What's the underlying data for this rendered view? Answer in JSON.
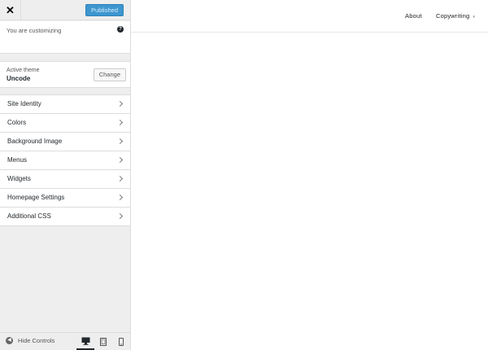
{
  "sidebar": {
    "close_icon": "✕",
    "published_label": "Published",
    "customizing_text": "You are customizing",
    "help_icon": "?",
    "theme": {
      "label": "Active theme",
      "name": "Uncode",
      "change_label": "Change"
    },
    "menu": [
      {
        "label": "Site Identity"
      },
      {
        "label": "Colors"
      },
      {
        "label": "Background Image"
      },
      {
        "label": "Menus"
      },
      {
        "label": "Widgets"
      },
      {
        "label": "Homepage Settings"
      },
      {
        "label": "Additional CSS"
      }
    ],
    "footer": {
      "hide_label": "Hide Controls",
      "devices": [
        "desktop-icon",
        "tablet-icon",
        "mobile-icon"
      ],
      "active_device": "desktop"
    }
  },
  "preview": {
    "nav": [
      {
        "label": "About"
      },
      {
        "label": "Copywriting",
        "has_dropdown": true
      }
    ]
  },
  "colors": {
    "accent": "#3e96cf",
    "sidebar_bg": "#eeeeee"
  }
}
